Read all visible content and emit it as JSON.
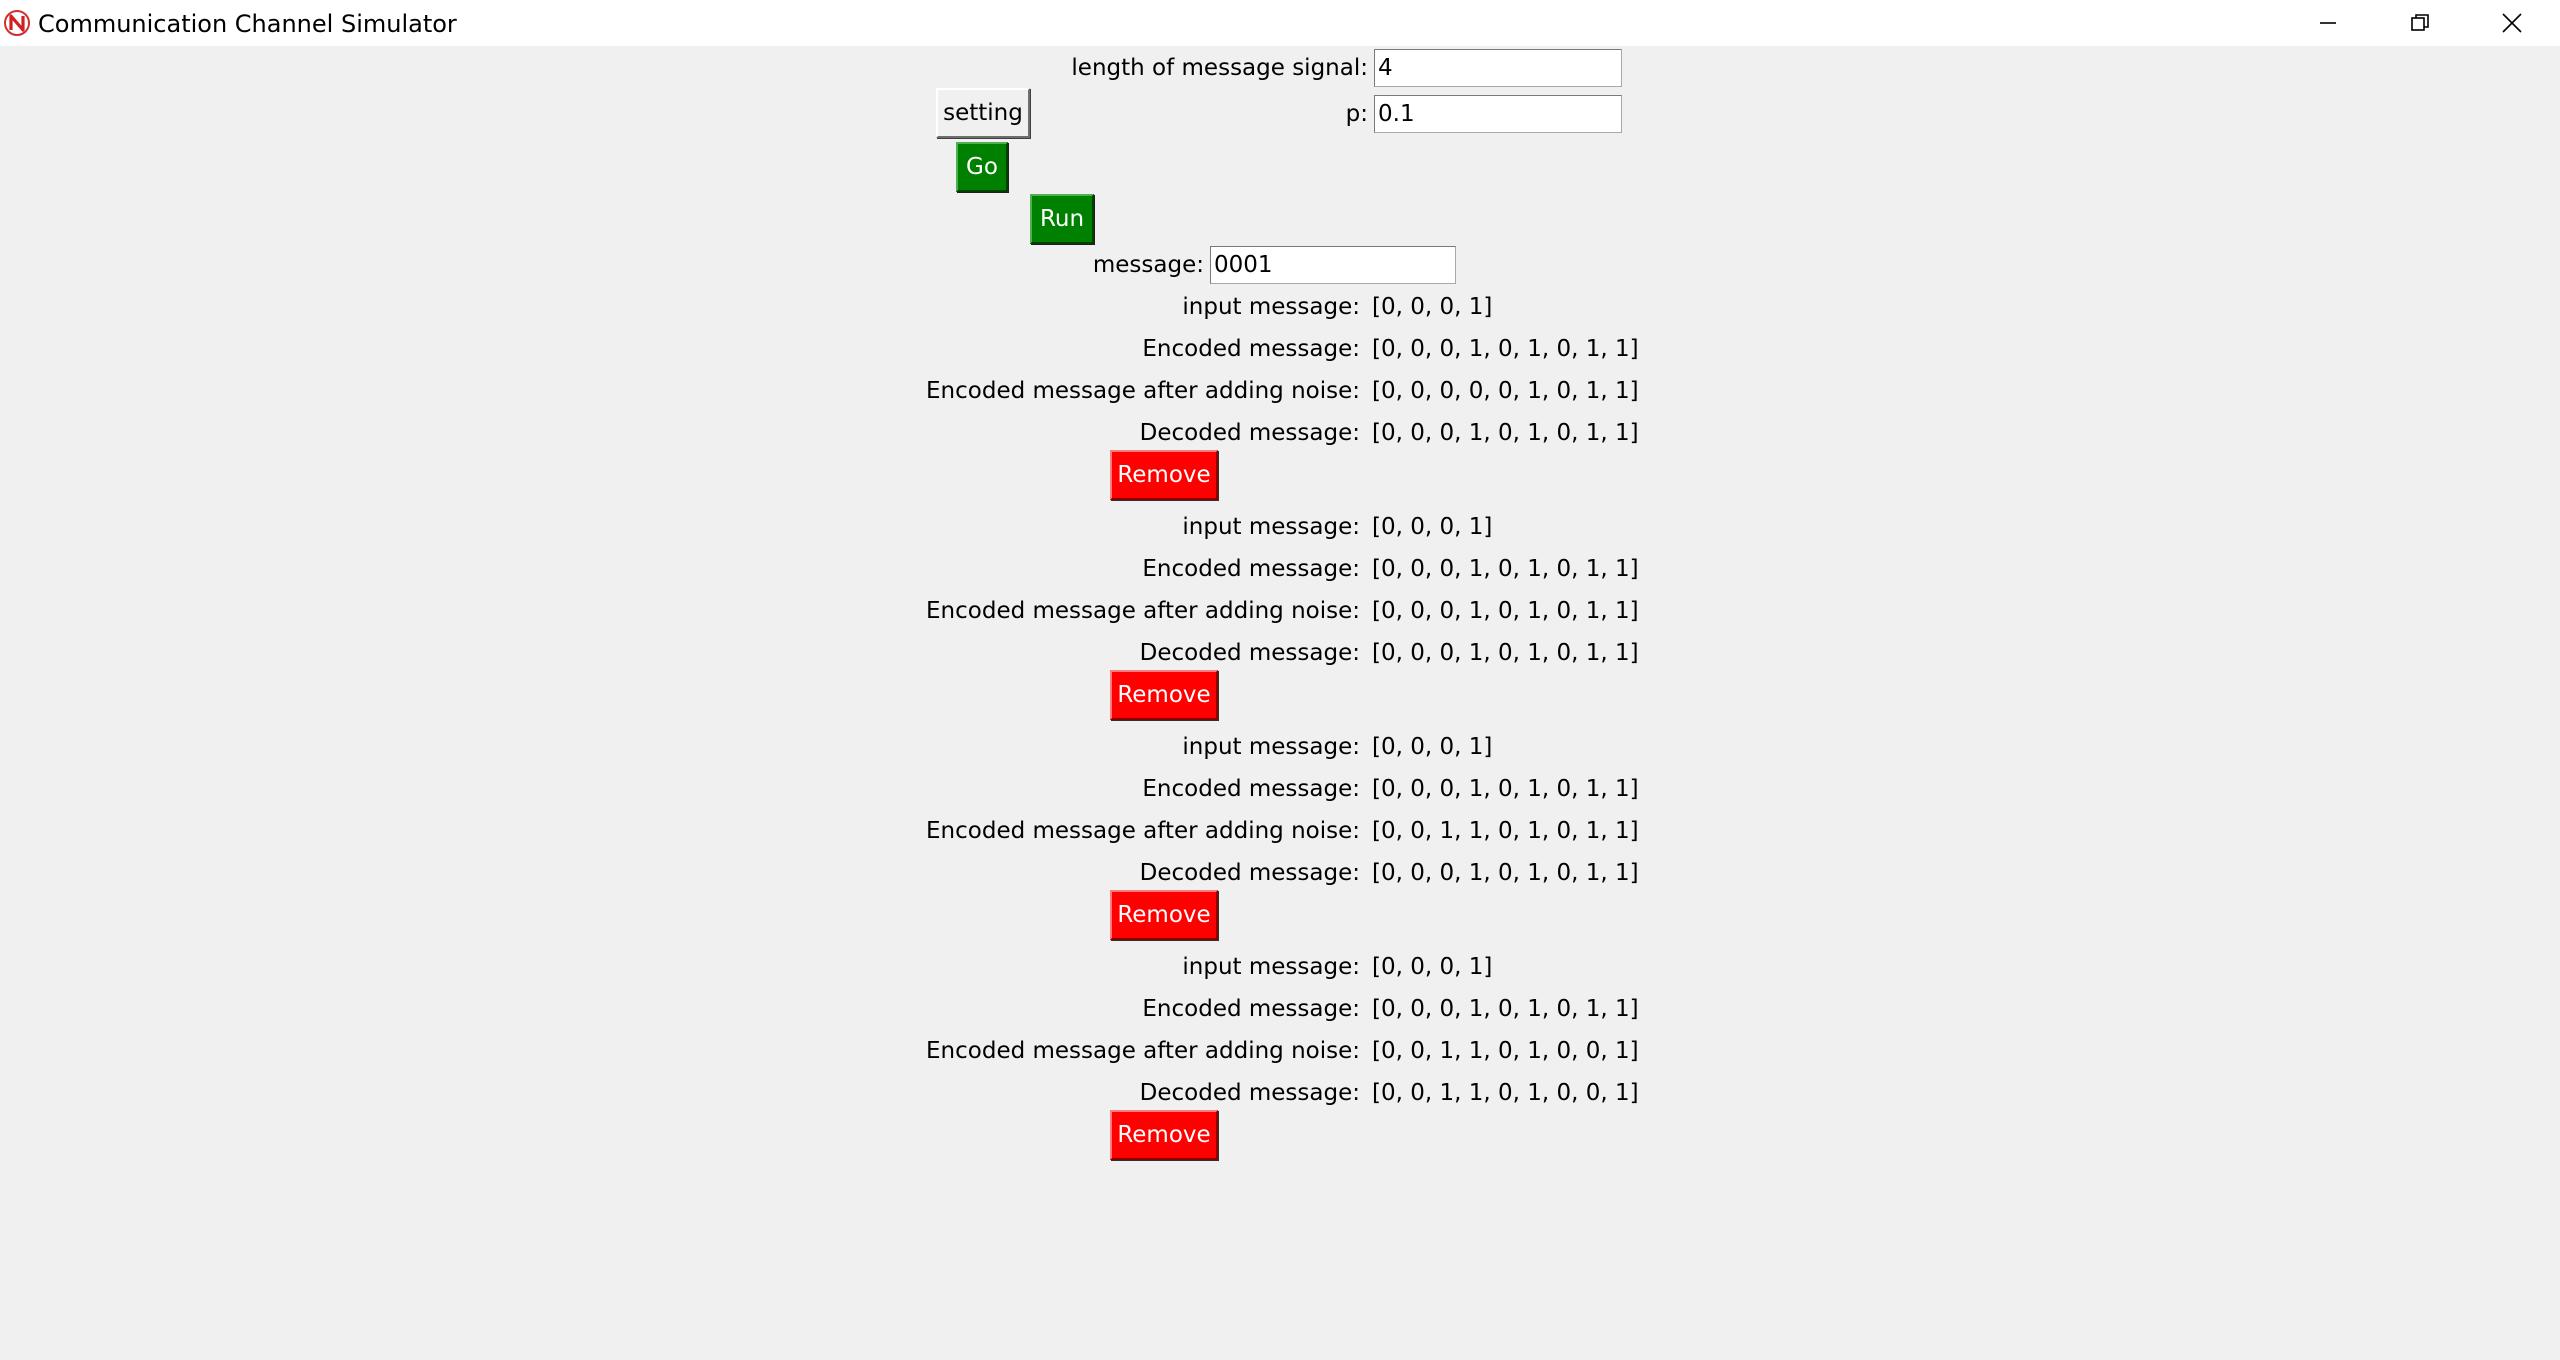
{
  "window": {
    "title": "Communication Channel Simulator",
    "controls": {
      "minimize": "minimize-icon",
      "maximize": "restore-icon",
      "close": "close-icon"
    }
  },
  "form": {
    "length_label": "length of message signal:",
    "length_value": "4",
    "setting_button": "setting",
    "p_label": "p:",
    "p_value": "0.1",
    "go_button": "Go",
    "run_button": "Run",
    "message_label": "message:",
    "message_value": "0001"
  },
  "colors": {
    "go_run": "#008000",
    "remove": "#ff0000"
  },
  "results": [
    {
      "input_label": "input message:",
      "input": "[0, 0, 0, 1]",
      "encoded_label": "Encoded message:",
      "encoded": "[0, 0, 0, 1, 0, 1, 0, 1, 1]",
      "noisy_label": "Encoded message after adding noise:",
      "noisy": "[0, 0, 0, 0, 0, 1, 0, 1, 1]",
      "decoded_label": "Decoded message:",
      "decoded": "[0, 0, 0, 1, 0, 1, 0, 1, 1]",
      "remove_label": "Remove"
    },
    {
      "input_label": "input message:",
      "input": "[0, 0, 0, 1]",
      "encoded_label": "Encoded message:",
      "encoded": "[0, 0, 0, 1, 0, 1, 0, 1, 1]",
      "noisy_label": "Encoded message after adding noise:",
      "noisy": "[0, 0, 0, 1, 0, 1, 0, 1, 1]",
      "decoded_label": "Decoded message:",
      "decoded": "[0, 0, 0, 1, 0, 1, 0, 1, 1]",
      "remove_label": "Remove"
    },
    {
      "input_label": "input message:",
      "input": "[0, 0, 0, 1]",
      "encoded_label": "Encoded message:",
      "encoded": "[0, 0, 0, 1, 0, 1, 0, 1, 1]",
      "noisy_label": "Encoded message after adding noise:",
      "noisy": "[0, 0, 1, 1, 0, 1, 0, 1, 1]",
      "decoded_label": "Decoded message:",
      "decoded": "[0, 0, 0, 1, 0, 1, 0, 1, 1]",
      "remove_label": "Remove"
    },
    {
      "input_label": "input message:",
      "input": "[0, 0, 0, 1]",
      "encoded_label": "Encoded message:",
      "encoded": "[0, 0, 0, 1, 0, 1, 0, 1, 1]",
      "noisy_label": "Encoded message after adding noise:",
      "noisy": "[0, 0, 1, 1, 0, 1, 0, 0, 1]",
      "decoded_label": "Decoded message:",
      "decoded": "[0, 0, 1, 1, 0, 1, 0, 0, 1]",
      "remove_label": "Remove"
    }
  ]
}
